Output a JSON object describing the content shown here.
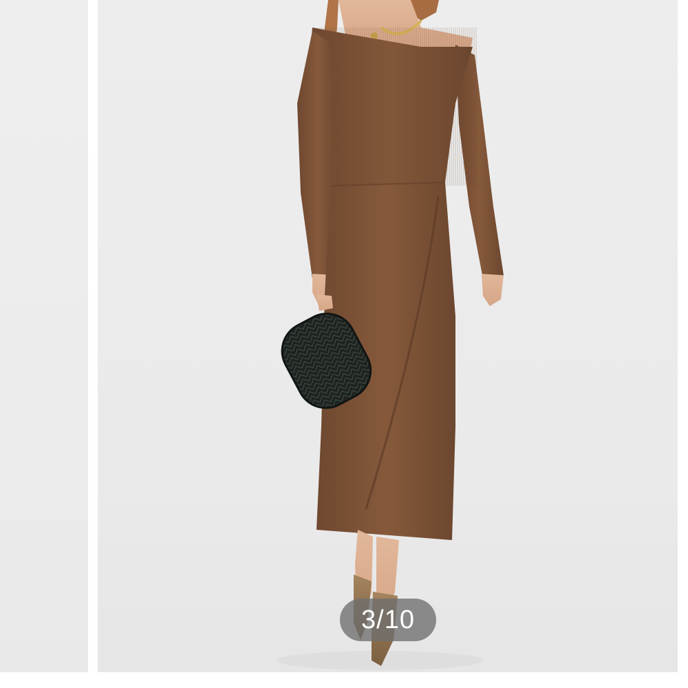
{
  "gallery": {
    "counter": "3/10",
    "current_index": 3,
    "total": 10,
    "current_image": {
      "subject": "model-wearing-knit-dress",
      "icon": "clutch-bag"
    }
  },
  "colors": {
    "dress": "#7d5438",
    "background": "#ececec",
    "counter_pill": "#6e6e6e",
    "counter_text": "#ffffff",
    "clutch": "#1e2320"
  }
}
